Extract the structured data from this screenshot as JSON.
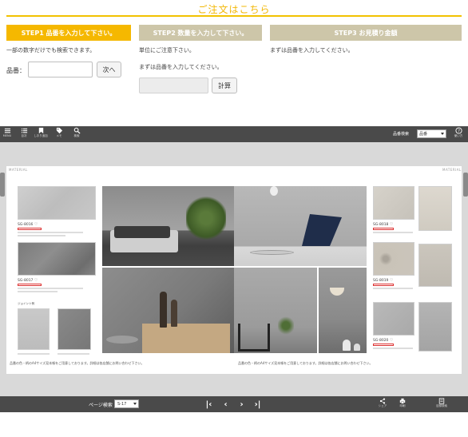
{
  "order": {
    "title": "ご注文はこちら",
    "step1": {
      "label": "STEP1 品番を入力して下さい。",
      "note": "一部の数字だけでも検索できます。",
      "field_label": "品番：",
      "next_button": "次へ",
      "color": "#f5b800"
    },
    "step2": {
      "label": "STEP2 数量を入力して下さい。",
      "note1": "単位にご注意下さい。",
      "note2": "まずは品番を入力してください。",
      "calc_button": "計算",
      "color": "#cdc6a9"
    },
    "step3": {
      "label": "STEP3 お見積り金額",
      "note": "まずは品番を入力してください。",
      "color": "#cdc6a9"
    }
  },
  "viewer": {
    "top_tools": [
      {
        "icon": "menu-icon",
        "label": "MENU"
      },
      {
        "icon": "list-icon",
        "label": "目次"
      },
      {
        "icon": "bookmark-icon",
        "label": "しおり追加"
      },
      {
        "icon": "tag-icon",
        "label": "メモ"
      },
      {
        "icon": "search-icon",
        "label": "検索"
      }
    ],
    "search_label": "品番検索",
    "search_select": "品番",
    "help_label": "使い方",
    "page_label": "ページ検索",
    "page_select": "S-17",
    "share_label": "シェア",
    "print_label": "印刷",
    "list_label": "目録検索",
    "spread": {
      "material_left": "MATERIAL",
      "material_right": "MATERIAL",
      "codes_left": [
        "SG-8016",
        "SG-8017"
      ],
      "codes_right": [
        "SG-8018",
        "SG-8019",
        "SG-8020"
      ],
      "joint_label": "ジョイント例",
      "footnote_left": "品番の色・柄のA4サイズ見本帳をご用意しております。詳細は各店舗にお問い合わせ下さい。",
      "footnote_right": "品番の色・柄のA4サイズ見本帳をご用意しております。詳細は各店舗にお問い合わせ下さい。"
    }
  }
}
